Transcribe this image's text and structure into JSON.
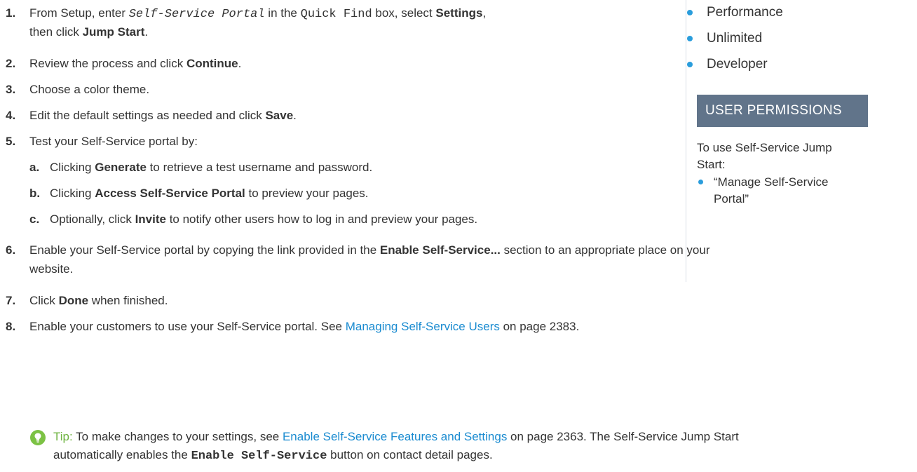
{
  "steps": {
    "s1": {
      "num": "1.",
      "a": "From Setup, enter ",
      "code1": "Self-Service Portal",
      "b": " in the ",
      "code2": "Quick Find",
      "c": " box, select ",
      "bold1": "Settings",
      "d": ",",
      "line2_a": "then click ",
      "bold2": "Jump Start",
      "line2_b": "."
    },
    "s2": {
      "num": "2.",
      "a": "Review the process and click ",
      "bold": "Continue",
      "b": "."
    },
    "s3": {
      "num": "3.",
      "a": "Choose a color theme."
    },
    "s4": {
      "num": "4.",
      "a": "Edit the default settings as needed and click ",
      "bold": "Save",
      "b": "."
    },
    "s5": {
      "num": "5.",
      "a": "Test your Self-Service portal by:"
    },
    "s5a": {
      "num": "a.",
      "a": "Clicking ",
      "bold": "Generate",
      "b": " to retrieve a test username and password."
    },
    "s5b": {
      "num": "b.",
      "a": "Clicking ",
      "bold": "Access Self-Service Portal",
      "b": " to preview your pages."
    },
    "s5c": {
      "num": "c.",
      "a": "Optionally, click ",
      "bold": "Invite",
      "b": " to notify other users how to log in and preview your pages."
    },
    "s6": {
      "num": "6.",
      "a": "Enable your Self-Service portal by copying the link provided in the ",
      "bold": "Enable Self-Service...",
      "b": " section to an appropriate place on your",
      "line2": "website."
    },
    "s7": {
      "num": "7.",
      "a": "Click ",
      "bold": "Done",
      "b": " when finished."
    },
    "s8": {
      "num": "8.",
      "a": "Enable your customers to use your Self-Service portal. See ",
      "link": "Managing Self-Service Users",
      "b": " on page 2383."
    }
  },
  "tip": {
    "label": "Tip:",
    "a": " To make changes to your settings, see ",
    "link": "Enable Self-Service Features and Settings",
    "b": " on page 2363. The Self-Service Jump Start",
    "line2_a": "automatically enables the ",
    "bold": "Enable Self-Service",
    "line2_b": " button on contact detail pages."
  },
  "sidebar": {
    "editions": [
      "Performance",
      "Unlimited",
      "Developer"
    ],
    "permissions_heading": "USER PERMISSIONS",
    "permissions_text_1": "To use Self-Service Jump",
    "permissions_text_2": "Start:",
    "permission_item_1": "“Manage Self-Service",
    "permission_item_2": "Portal”"
  },
  "colors": {
    "link": "#1a8bd0",
    "bullet": "#2a9ddc",
    "heading_bg": "#61748a",
    "tip_icon": "#7cc244"
  }
}
